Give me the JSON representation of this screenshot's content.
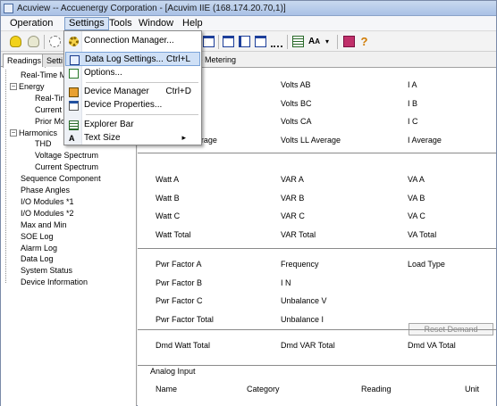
{
  "window": {
    "title": "Acuview -- Accuenergy Corporation - [Acuvim IIE (168.174.20.70,1)]"
  },
  "menubar": {
    "items": [
      "Operation",
      "Settings",
      "Tools",
      "Window",
      "Help"
    ],
    "active": "Settings"
  },
  "toolbar": {
    "icons": [
      "bulb-icon",
      "bulb-off-icon",
      "sun-icon",
      "window-horizontal-icon",
      "window-vertical-icon",
      "cascade-icon",
      "more-dots-icon",
      "explorer-bar-icon",
      "text-size-icon",
      "dropdown-arrow-icon",
      "book-icon",
      "help-icon"
    ],
    "text_size_label": "A",
    "text_size_label_small": "A",
    "help_label": "?"
  },
  "left_panel": {
    "tabs": [
      "Readings",
      "Setti"
    ],
    "tree": [
      {
        "label": "Real-Time M",
        "level": 0,
        "expander": ""
      },
      {
        "label": "Energy",
        "level": 0,
        "expander": "−"
      },
      {
        "label": "Real-Tim",
        "level": 1,
        "expander": ""
      },
      {
        "label": "Current",
        "level": 1,
        "expander": ""
      },
      {
        "label": "Prior Mo",
        "level": 1,
        "expander": ""
      },
      {
        "label": "Harmonics",
        "level": 0,
        "expander": "−"
      },
      {
        "label": "THD",
        "level": 1,
        "expander": ""
      },
      {
        "label": "Voltage Spectrum",
        "level": 1,
        "expander": ""
      },
      {
        "label": "Current Spectrum",
        "level": 1,
        "expander": ""
      },
      {
        "label": "Sequence Component",
        "level": 0,
        "expander": ""
      },
      {
        "label": "Phase Angles",
        "level": 0,
        "expander": ""
      },
      {
        "label": "I/O Modules *1",
        "level": 0,
        "expander": ""
      },
      {
        "label": "I/O Modules *2",
        "level": 0,
        "expander": ""
      },
      {
        "label": "Max and Min",
        "level": 0,
        "expander": ""
      },
      {
        "label": "SOE Log",
        "level": 0,
        "expander": ""
      },
      {
        "label": "Alarm Log",
        "level": 0,
        "expander": ""
      },
      {
        "label": "Data Log",
        "level": 0,
        "expander": ""
      },
      {
        "label": "System Status",
        "level": 0,
        "expander": ""
      },
      {
        "label": "Device Information",
        "level": 0,
        "expander": ""
      }
    ]
  },
  "right_panel": {
    "tab_label": "ime Metering",
    "groups": [
      {
        "rows": [
          [
            "",
            "Volts AB",
            "I A"
          ],
          [
            "",
            "Volts BC",
            "I B"
          ],
          [
            "",
            "Volts CA",
            "I C"
          ],
          [
            "Volts LN Average",
            "Volts LL Average",
            "I Average"
          ]
        ]
      },
      {
        "rows": [
          [
            "Watt A",
            "VAR A",
            "VA A"
          ],
          [
            "Watt B",
            "VAR B",
            "VA B"
          ],
          [
            "Watt C",
            "VAR C",
            "VA C"
          ],
          [
            "Watt Total",
            "VAR Total",
            "VA Total"
          ]
        ]
      },
      {
        "rows": [
          [
            "Pwr Factor A",
            "Frequency",
            "Load Type"
          ],
          [
            "Pwr Factor B",
            "I N",
            ""
          ],
          [
            "Pwr Factor C",
            "Unbalance V",
            ""
          ],
          [
            "Pwr Factor Total",
            "Unbalance I",
            ""
          ]
        ]
      },
      {
        "rows": [
          [
            "Dmd Watt Total",
            "Dmd VAR Total",
            "Dmd VA Total"
          ]
        ]
      }
    ],
    "reset_button": "Reset Demand",
    "analog": {
      "title": "Analog Input",
      "columns": [
        "Name",
        "Category",
        "Reading",
        "Unit"
      ]
    }
  },
  "settings_menu": {
    "items": [
      {
        "label": "Connection Manager...",
        "shortcut": "",
        "icon": "gear-icon",
        "highlighted": false,
        "submenu": false
      },
      {
        "label": "Data Log Settings...",
        "shortcut": "Ctrl+L",
        "icon": "data-log-icon",
        "highlighted": true,
        "submenu": false
      },
      {
        "label": "Options...",
        "shortcut": "",
        "icon": "checkbox-icon",
        "highlighted": false,
        "submenu": false
      },
      {
        "label": "Device Manager",
        "shortcut": "Ctrl+D",
        "icon": "device-icon",
        "highlighted": false,
        "submenu": false
      },
      {
        "label": "Device Properties...",
        "shortcut": "",
        "icon": "properties-icon",
        "highlighted": false,
        "submenu": false
      },
      {
        "label": "Explorer Bar",
        "shortcut": "",
        "icon": "explorer-bar-icon",
        "highlighted": false,
        "submenu": false
      },
      {
        "label": "Text Size",
        "shortcut": "",
        "icon": "text-size-icon",
        "highlighted": false,
        "submenu": true
      }
    ],
    "submenu_arrow": "▸",
    "text_size_icon_label": "A"
  }
}
